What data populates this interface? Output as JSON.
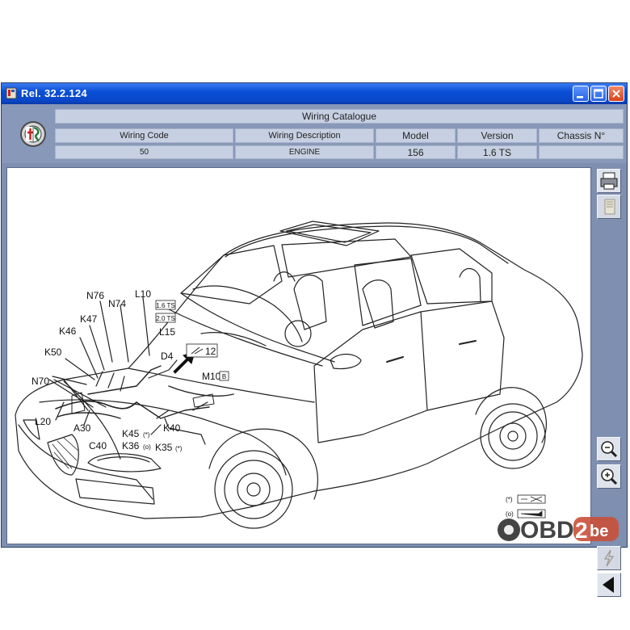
{
  "window": {
    "title": "Rel. 32.2.124"
  },
  "header": {
    "title": "Wiring Catalogue",
    "columns": {
      "wiring_code": {
        "label": "Wiring Code",
        "value": "50"
      },
      "wiring_description": {
        "label": "Wiring Description",
        "value": "ENGINE"
      },
      "model": {
        "label": "Model",
        "value": "156"
      },
      "version": {
        "label": "Version",
        "value": "1.6 TS"
      },
      "chassis": {
        "label": "Chassis N°",
        "value": ""
      }
    }
  },
  "diagram": {
    "callouts": {
      "N76": "N76",
      "N74": "N74",
      "L10": "L10",
      "K47": "K47",
      "K46": "K46",
      "L15": "L15",
      "K50": "K50",
      "D4": "D4",
      "ref12": "12",
      "M10": "M10",
      "M10_badge": "B",
      "N70": "N70",
      "L20": "L20",
      "A30": "A30",
      "K40": "K40",
      "K45": "K45",
      "K45_mark": "(*)",
      "C40": "C40",
      "K36": "K36",
      "K36_mark": "(o)",
      "K35": "K35",
      "K35_mark": "(*)",
      "box_top": "1.6 TS",
      "box_bottom": "2.0 TS"
    },
    "legend": {
      "asterisk": "(*)",
      "circle": "(o)"
    }
  },
  "watermark": {
    "text_a": "OBD",
    "text_b": "2",
    "text_c": "be"
  },
  "icons": {
    "print": "printer-icon",
    "book": "book-icon",
    "zoom_out": "zoom-out-icon",
    "zoom_in": "zoom-in-icon",
    "flash": "lightning-icon",
    "back": "back-arrow-icon"
  },
  "colors": {
    "titlebar": "#0a4fd6",
    "frame": "#7f8fb0",
    "header_cell": "#c7d0e2",
    "close": "#d9431a"
  }
}
